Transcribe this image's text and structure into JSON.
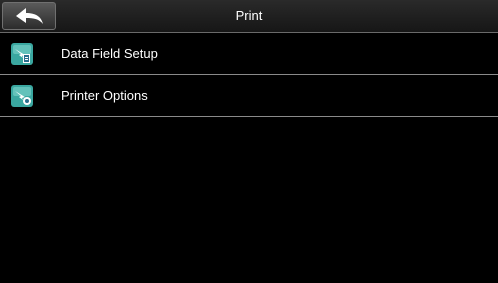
{
  "header": {
    "title": "Print",
    "back_icon": "back-arrow-icon"
  },
  "menu": {
    "items": [
      {
        "label": "Data Field Setup",
        "icon": "data-field-setup-icon"
      },
      {
        "label": "Printer Options",
        "icon": "printer-options-icon"
      }
    ]
  },
  "colors": {
    "background": "#000000",
    "text": "#ffffff",
    "icon_accent": "#3aa7a0",
    "divider": "#8a8a8a"
  }
}
